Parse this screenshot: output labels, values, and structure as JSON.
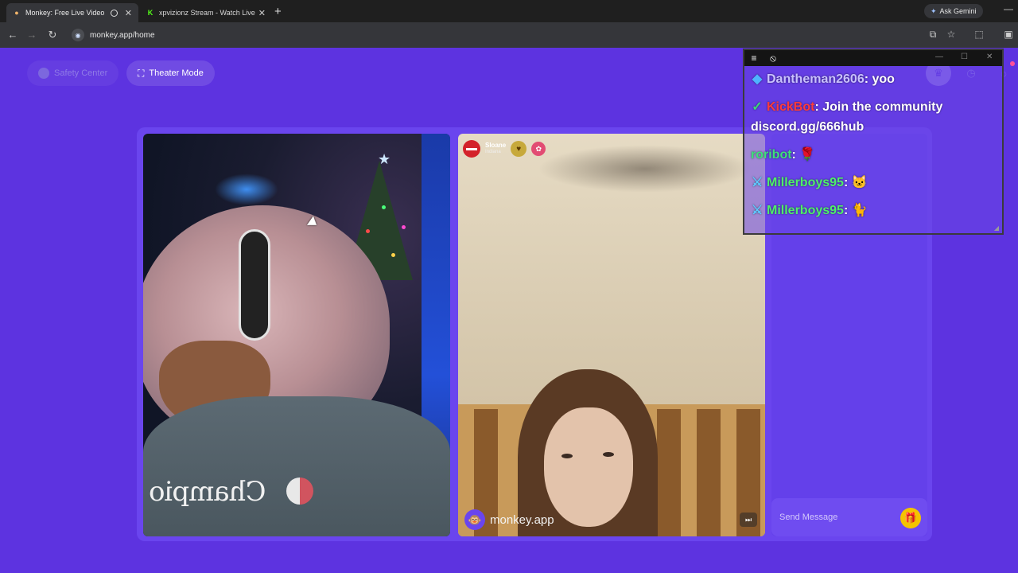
{
  "browser": {
    "tabs": [
      {
        "title": "Monkey: Free Live Video Ch",
        "active": true,
        "icon": "monkey-favicon"
      },
      {
        "title": "xpvizionz Stream - Watch Live o",
        "active": false,
        "icon": "kick-favicon"
      }
    ],
    "ask_gemini": "Ask Gemini",
    "url": "monkey.app/home"
  },
  "page": {
    "safety_center": "Safety Center",
    "theater_mode": "Theater Mode",
    "remote_user": {
      "name": "Sloane",
      "location": "Indiana"
    },
    "watermark": "monkey.app",
    "send_message_placeholder": "Send Message"
  },
  "overlay_chat": {
    "messages": [
      {
        "user": "Dantheman2606",
        "sep": ": ",
        "text": "yoo",
        "color": "#c9c1ff",
        "badge": "cube-icon"
      },
      {
        "user": "KickBot",
        "sep": ": ",
        "text": "Join the community discord.gg/666hub",
        "color": "#ff3b3b",
        "badge": "verified-icon"
      },
      {
        "user": "roribot",
        "sep": ": ",
        "text": "🌹",
        "color": "#3ee07a",
        "badge": ""
      },
      {
        "user": "Millerboys95",
        "sep": ": ",
        "text": "🐱",
        "color": "#4ff06a",
        "badge": "sword-icon"
      },
      {
        "user": "Millerboys95",
        "sep": ": ",
        "text": "🐈",
        "color": "#4ff06a",
        "badge": "sword-icon"
      }
    ]
  },
  "colors": {
    "page_bg": "#5d33e0",
    "accent": "#6a45ee",
    "gift": "#f4c400"
  }
}
